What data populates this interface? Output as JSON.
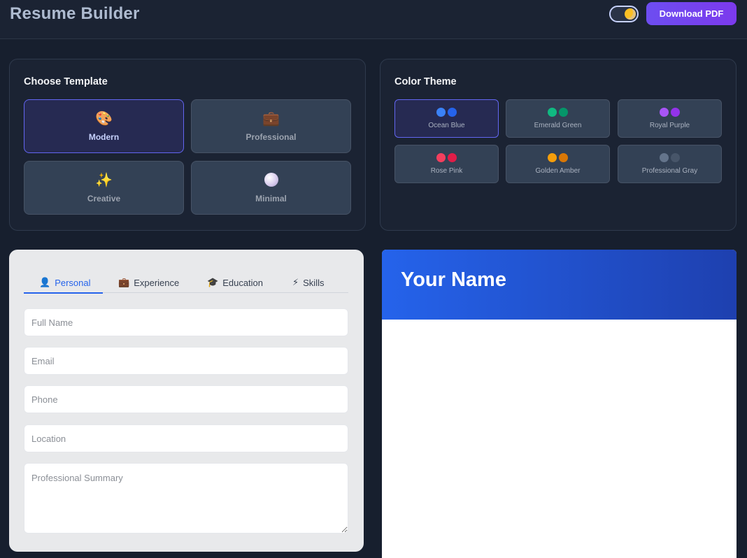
{
  "header": {
    "title": "Resume Builder",
    "download_label": "Download PDF"
  },
  "templates": {
    "title": "Choose Template",
    "items": [
      {
        "label": "Modern",
        "icon": "palette-icon",
        "active": true
      },
      {
        "label": "Professional",
        "icon": "briefcase-icon",
        "active": false
      },
      {
        "label": "Creative",
        "icon": "sparkles-icon",
        "active": false
      },
      {
        "label": "Minimal",
        "icon": "pearl-icon",
        "active": false
      }
    ]
  },
  "themes": {
    "title": "Color Theme",
    "items": [
      {
        "label": "Ocean Blue",
        "colors": [
          "#3b82f6",
          "#2563eb"
        ],
        "active": true
      },
      {
        "label": "Emerald Green",
        "colors": [
          "#10b981",
          "#059669"
        ],
        "active": false
      },
      {
        "label": "Royal Purple",
        "colors": [
          "#a855f7",
          "#9333ea"
        ],
        "active": false
      },
      {
        "label": "Rose Pink",
        "colors": [
          "#f43f5e",
          "#e11d48"
        ],
        "active": false
      },
      {
        "label": "Golden Amber",
        "colors": [
          "#f59e0b",
          "#d97706"
        ],
        "active": false
      },
      {
        "label": "Professional Gray",
        "colors": [
          "#64748b",
          "#475569"
        ],
        "active": false
      }
    ]
  },
  "form": {
    "tabs": [
      {
        "label": "Personal",
        "icon": "person-icon",
        "active": true
      },
      {
        "label": "Experience",
        "icon": "briefcase-icon",
        "active": false
      },
      {
        "label": "Education",
        "icon": "graduation-cap-icon",
        "active": false
      },
      {
        "label": "Skills",
        "icon": "lightning-icon",
        "active": false
      }
    ],
    "fields": {
      "full_name": {
        "placeholder": "Full Name",
        "value": ""
      },
      "email": {
        "placeholder": "Email",
        "value": ""
      },
      "phone": {
        "placeholder": "Phone",
        "value": ""
      },
      "location": {
        "placeholder": "Location",
        "value": ""
      },
      "summary": {
        "placeholder": "Professional Summary",
        "value": ""
      }
    }
  },
  "preview": {
    "name": "Your Name"
  }
}
